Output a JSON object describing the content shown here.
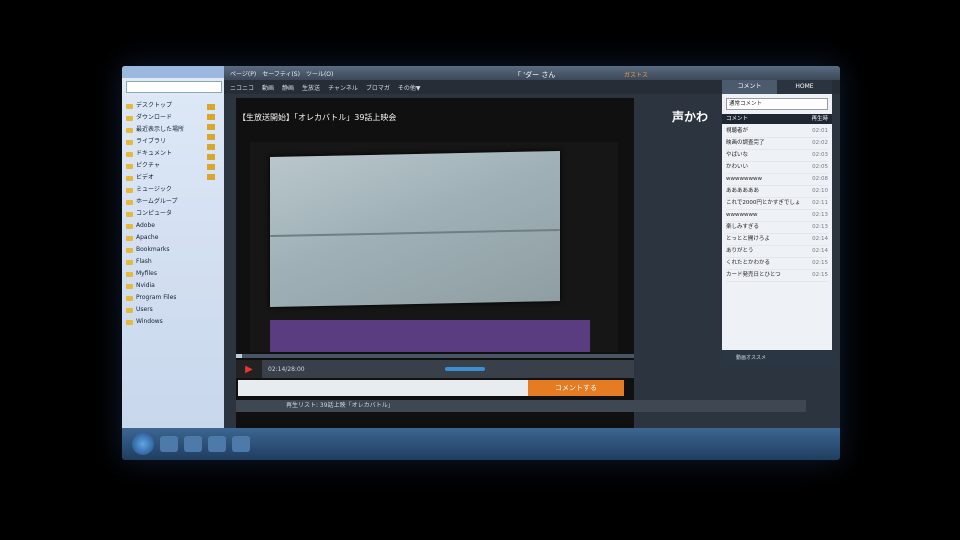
{
  "explorer": {
    "tree": [
      "デスクトップ",
      "ダウンロード",
      "最近表示した場所",
      "ライブラリ",
      "ドキュメント",
      "ピクチャ",
      "ビデオ",
      "ミュージック",
      "ホームグループ",
      "コンピュータ",
      "Adobe",
      "Apache",
      "Bookmarks",
      "Flash",
      "Myfiles",
      "Nvidia",
      "Program Files",
      "Users",
      "Windows"
    ]
  },
  "browser": {
    "toolbar": [
      "ページ(P)",
      "セーフティ(S)",
      "ツール(O)"
    ],
    "menu": [
      "ニコニコ",
      "動画",
      "静画",
      "生放送",
      "チャンネル",
      "ブロマガ",
      "その他▼"
    ],
    "user": "「 'ダー さん",
    "orange_text": "ガストス",
    "side_title": "声かわ"
  },
  "player": {
    "title": "【生放送開始】「オレカバトル」39話上映会",
    "time": "02:14/28:00",
    "orange_btn": "コメントする"
  },
  "comments": {
    "tab1": "コメント",
    "tab2": "HOME",
    "field": "通常コメント",
    "col1": "コメント",
    "col2": "再生時",
    "rows": [
      [
        "視聴者が",
        "02:01"
      ],
      [
        "映画の調査完了",
        "02:02"
      ],
      [
        "やばいな",
        "02:03"
      ],
      [
        "かわいい",
        "02:05"
      ],
      [
        "wwwwwwww",
        "02:08"
      ],
      [
        "ああああああ",
        "02:10"
      ],
      [
        "これで2000円とかすぎでしょ",
        "02:11"
      ],
      [
        "wwwwwww",
        "02:13"
      ],
      [
        "楽しみすぎる",
        "02:13"
      ],
      [
        "とっとと開けろよ",
        "02:14"
      ],
      [
        "ありがとう",
        "02:14"
      ],
      [
        "くれたとかわかる",
        "02:15"
      ],
      [
        "カード発売日とひとつ",
        "02:15"
      ]
    ],
    "notice": "動画オススメ"
  },
  "bottombar": "再生リスト: 39話上映「オレカバトル」",
  "taskbar": {
    "tray": ""
  }
}
